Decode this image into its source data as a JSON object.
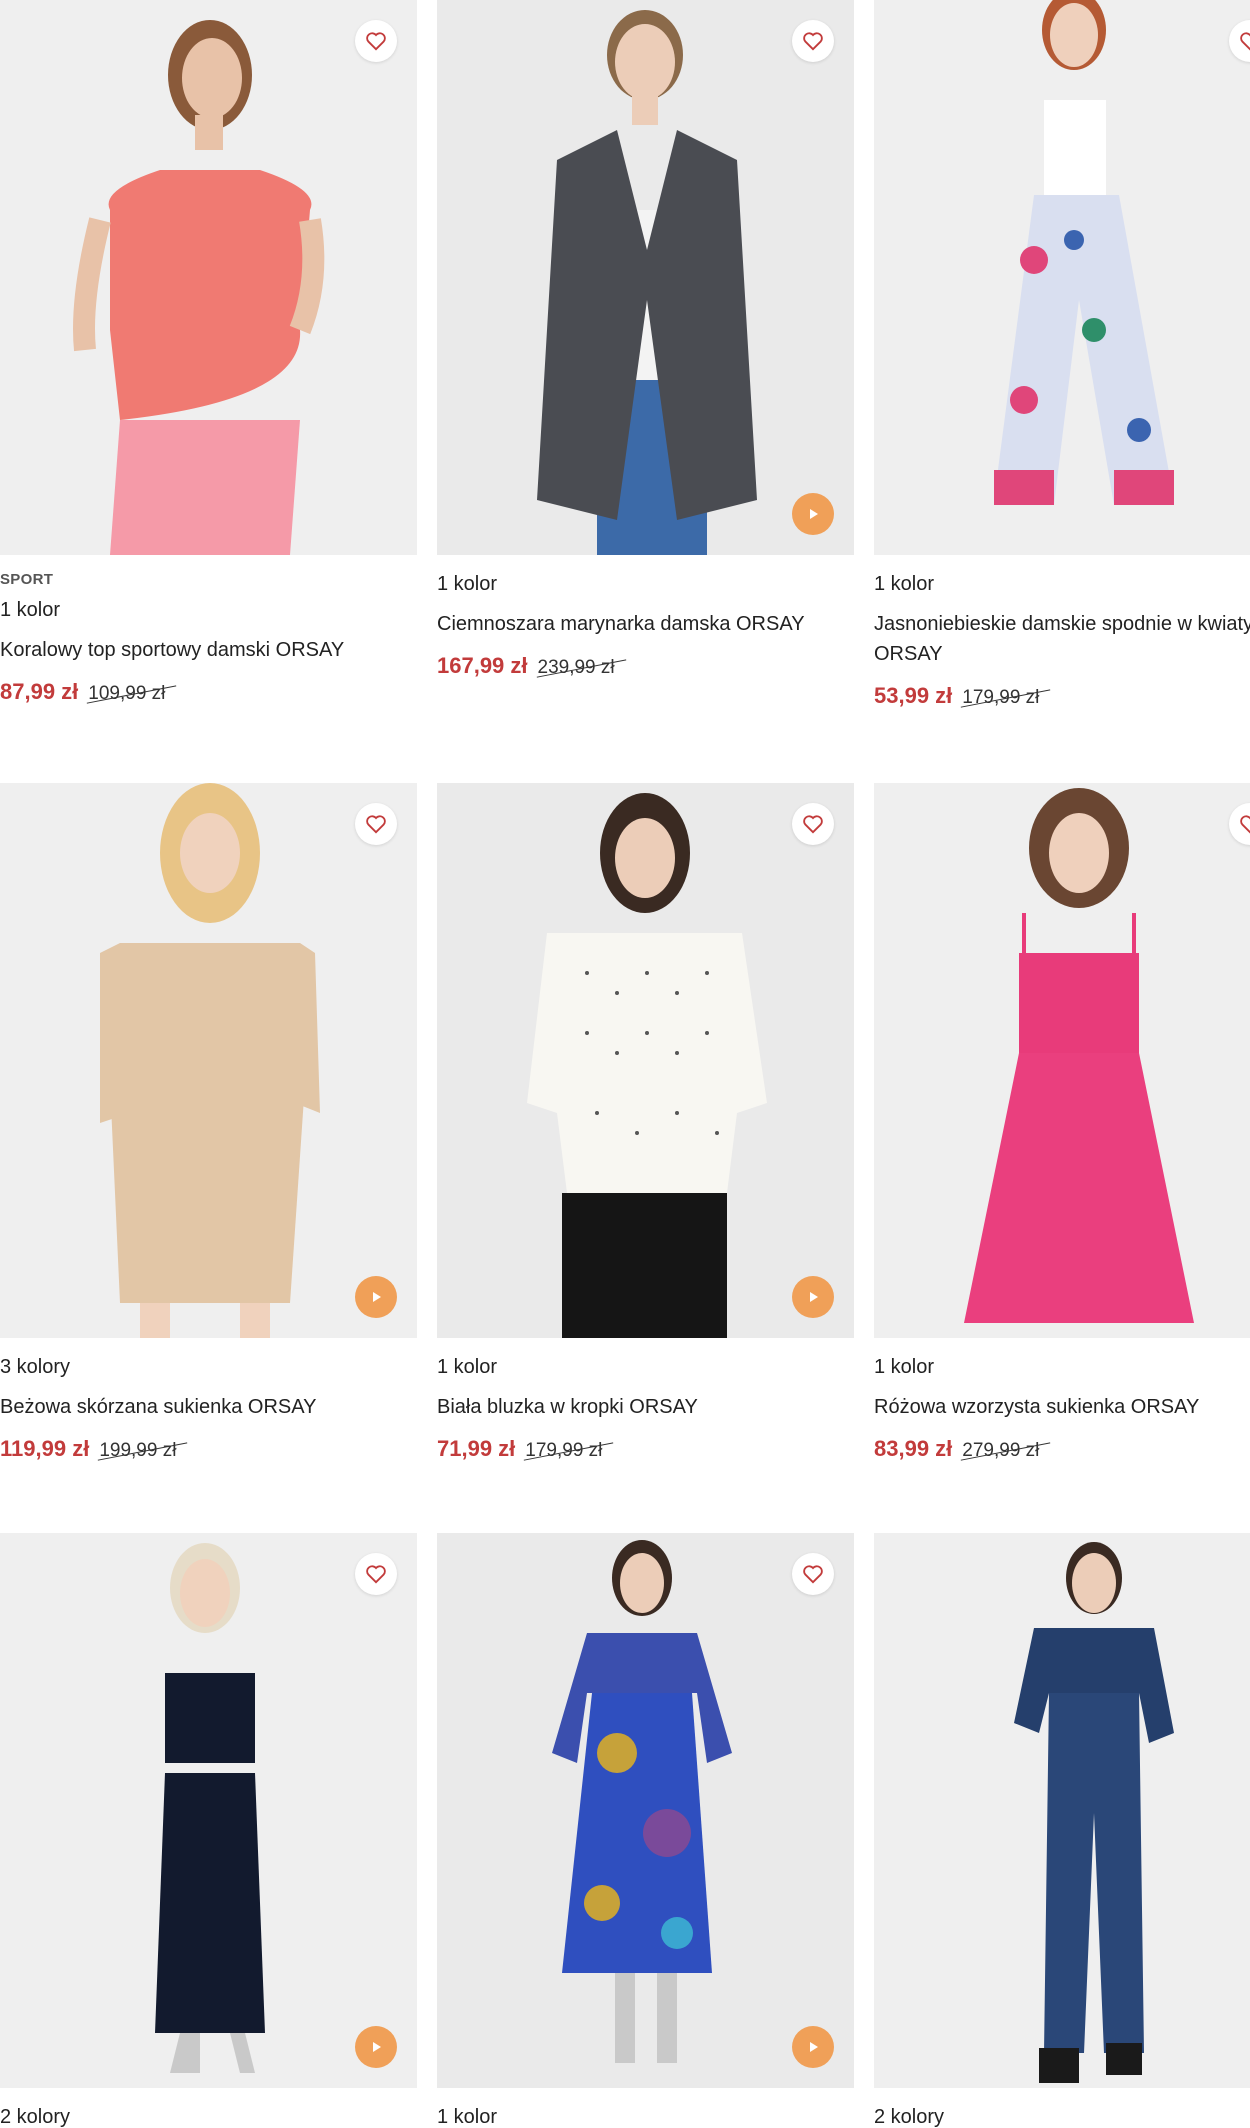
{
  "products": [
    {
      "badge": "SPORT",
      "colors": "1 kolor",
      "name": "Koralowy top sportowy damski ORSAY",
      "price": "87,99 zł",
      "old_price": "109,99 zł",
      "video": false
    },
    {
      "badge": "",
      "colors": "1 kolor",
      "name": "Ciemnoszara marynarka damska ORSAY",
      "price": "167,99 zł",
      "old_price": "239,99 zł",
      "video": true
    },
    {
      "badge": "",
      "colors": "1 kolor",
      "name": "Jasnoniebieskie damskie spodnie w kwiaty ORSAY",
      "price": "53,99 zł",
      "old_price": "179,99 zł",
      "video": false
    },
    {
      "badge": "",
      "colors": "3 kolory",
      "name": "Beżowa skórzana sukienka ORSAY",
      "price": "119,99 zł",
      "old_price": "199,99 zł",
      "video": true
    },
    {
      "badge": "",
      "colors": "1 kolor",
      "name": "Biała bluzka w kropki ORSAY",
      "price": "71,99 zł",
      "old_price": "179,99 zł",
      "video": true
    },
    {
      "badge": "",
      "colors": "1 kolor",
      "name": "Różowa wzorzysta sukienka ORSAY",
      "price": "83,99 zł",
      "old_price": "279,99 zł",
      "video": false
    },
    {
      "badge": "",
      "colors": "2 kolory",
      "name": "",
      "price": "",
      "old_price": "",
      "video": true
    },
    {
      "badge": "",
      "colors": "1 kolor",
      "name": "",
      "price": "",
      "old_price": "",
      "video": true
    },
    {
      "badge": "",
      "colors": "2 kolory",
      "name": "",
      "price": "",
      "old_price": "",
      "video": true
    }
  ],
  "icons": {
    "favorite": "heart-icon",
    "video": "play-icon"
  },
  "colors": {
    "sale_price": "#c23b3b",
    "play_button": "#f0a058",
    "heart": "#c23b3b",
    "image_bg": "#efefef"
  }
}
